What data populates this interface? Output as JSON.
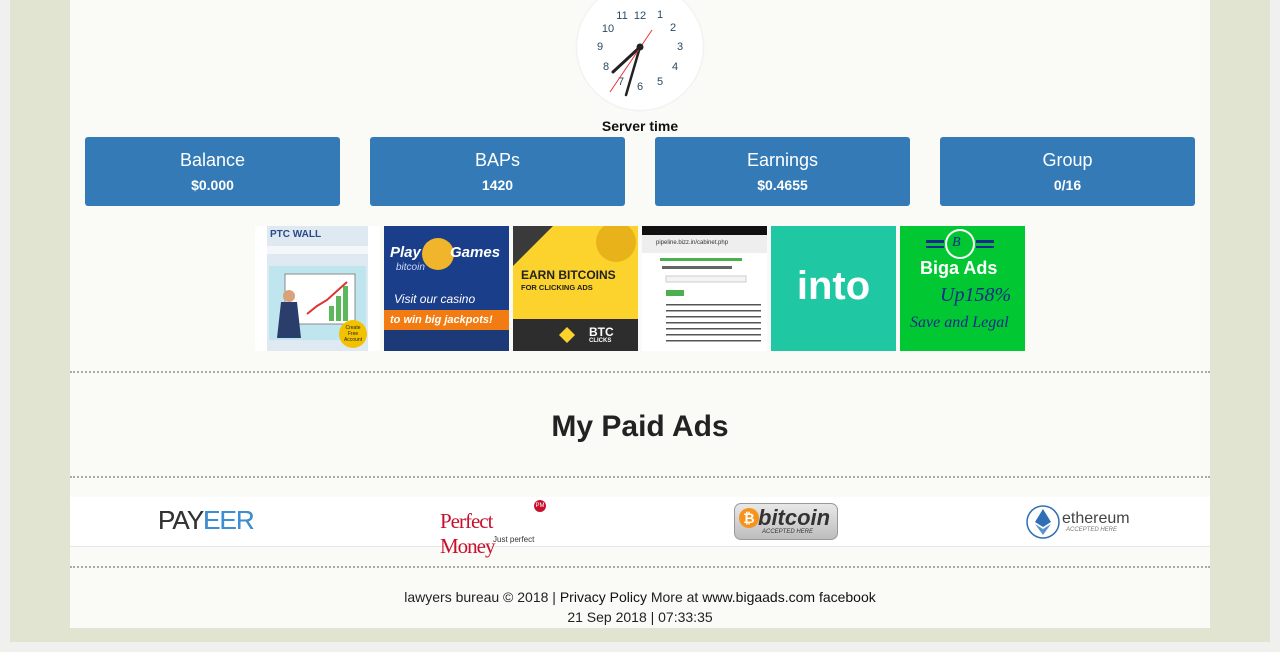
{
  "clock": {
    "numbers": [
      "12",
      "1",
      "2",
      "3",
      "4",
      "5",
      "6",
      "7",
      "8",
      "9",
      "10",
      "11"
    ],
    "label": "Server time"
  },
  "stats": [
    {
      "title": "Balance",
      "value": "$0.000"
    },
    {
      "title": "BAPs",
      "value": "1420"
    },
    {
      "title": "Earnings",
      "value": "$0.4655"
    },
    {
      "title": "Group",
      "value": "0/16"
    }
  ],
  "banners": {
    "ptcwall": {
      "logo": "PTC WALL",
      "badge_line1": "Create",
      "badge_line2": "Free",
      "badge_line3": "Account"
    },
    "casino": {
      "line1": "Play",
      "line2": "Games",
      "line3": "bitcoin",
      "line4": "Visit our casino",
      "line5": "to win big jackpots!"
    },
    "btcclicks": {
      "line1": "EARN BITCOINS",
      "line2": "FOR CLICKING ADS",
      "brand": "BTC",
      "brand_sub": "CLICKS"
    },
    "screenshot": {
      "url": "pipeline.bizz.in/cabinet.php"
    },
    "into": {
      "text": "into"
    },
    "bigaads": {
      "letter": "B",
      "title": "Biga Ads",
      "up": "Up158%",
      "tagline": "Save and Legal"
    }
  },
  "paid_ads_title": "My Paid Ads",
  "payments": {
    "payeer": "PAYEER",
    "perfect_money": "Perfect Money",
    "perfect_money_sub": "Just perfect",
    "perfect_money_badge": "PM",
    "bitcoin": "bitcoin",
    "bitcoin_sub": "ACCEPTED HERE",
    "ethereum": "ethereum",
    "ethereum_sub": "ACCEPTED HERE"
  },
  "footer": {
    "copyright": "lawyers bureau © 2018 |",
    "privacy": "Privacy Policy",
    "more_at": "More at",
    "site": "www.bigaads.com",
    "facebook": "facebook",
    "datetime": "21 Sep 2018 | 07:33:35"
  },
  "colors": {
    "stat_bg": "#337ab7",
    "outer_bg": "#e1e4d0",
    "into_bg": "#1fc7a2",
    "bigaads_bg": "#00c732"
  }
}
